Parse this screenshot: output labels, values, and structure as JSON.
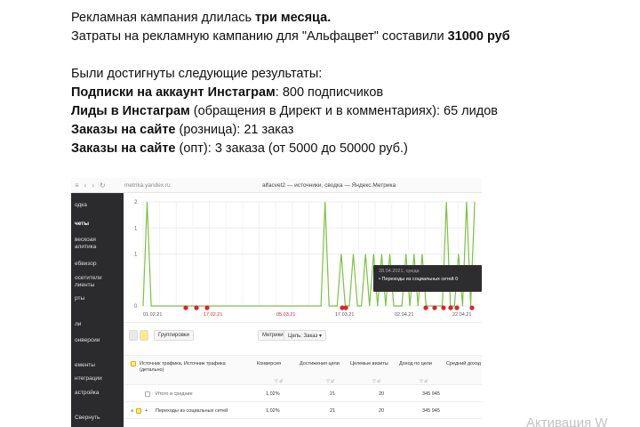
{
  "doc": {
    "l1_plain": "Рекламная кампания длилась ",
    "l1_bold": "три месяца.",
    "l2_plain": "Затраты на рекламную кампанию для \"Альфацвет\" составили ",
    "l2_bold": "31000 руб",
    "l3": "Были достигнуты следующие результаты:",
    "l4_bold": "Подписки на аккаунт Инстаграм",
    "l4_plain": ": 800 подписчиков",
    "l5_bold": "Лиды в Инстаграм",
    "l5_plain": " (обращения в Директ и в комментариях): 65 лидов",
    "l6_bold": "Заказы на сайте",
    "l6_plain": " (розница): 21 заказ",
    "l7_bold": "Заказы на сайте",
    "l7_plain": " (опт): 3 заказа (от 5000 до 50000 руб.)"
  },
  "browser": {
    "url": "metrika.yandex.ru",
    "title": "alfacvet2 — источники, сводка — Яндекс.Метрика"
  },
  "sidebar": {
    "items": [
      "одка",
      "четы",
      "вескоая",
      "алитика",
      "ебвизор",
      "осетители",
      "лиенты",
      "рты",
      "ли",
      "онверсии",
      "ементы",
      "нтеграции",
      "астройка",
      "Свернуть"
    ]
  },
  "chart_data": {
    "type": "line",
    "y_ticks": [
      "2",
      "1",
      "1",
      "0"
    ],
    "x_ticks": [
      "01.02.21",
      "17.02.21",
      "05.03.21",
      "17.03.21",
      "02.04.21",
      "22.04.21"
    ],
    "series": [
      {
        "values": [
          0,
          2,
          0,
          0,
          0,
          0,
          0,
          0,
          0,
          0,
          0,
          0,
          0,
          0,
          0,
          0,
          0,
          0,
          0,
          0,
          0,
          0,
          0,
          0,
          0,
          0,
          0,
          0,
          0,
          0,
          0,
          0,
          0,
          0,
          0,
          0,
          0,
          0,
          0,
          0,
          0,
          0,
          0,
          0,
          0,
          2,
          0,
          0,
          0,
          1,
          0,
          0,
          1,
          0,
          0,
          1,
          0,
          1,
          0,
          1,
          0,
          1,
          0,
          0,
          0,
          1,
          0,
          1,
          0,
          1,
          0,
          0,
          0,
          0,
          0,
          2,
          0,
          0,
          1,
          0,
          2,
          0,
          2
        ]
      }
    ],
    "color": "#7cc242"
  },
  "tooltip": {
    "date": "28.04.2021, среда",
    "text": "• Переходы из социальных сетей",
    "value": "0"
  },
  "table": {
    "btn_group": "Группировки",
    "btn_metrics": "Метрики",
    "btn_goal": "Цель: Заказ ▾",
    "headers": {
      "source": "Источник трафика, Источник трафика (детально)",
      "conv": "Конверсия",
      "reach": "Достижения цели",
      "visits": "Целевые визиты",
      "income": "Доход по цели",
      "avg": "Средний доход"
    },
    "total": {
      "label": "Итого и средние",
      "conv": "1,02%",
      "reach": "21",
      "visits": "20",
      "income": "345 945"
    },
    "row1": {
      "label": "Переходы из социальных сетей",
      "conv": "1,02%",
      "reach": "21",
      "visits": "20",
      "income": "345 945"
    }
  },
  "watermark": "Активация W"
}
